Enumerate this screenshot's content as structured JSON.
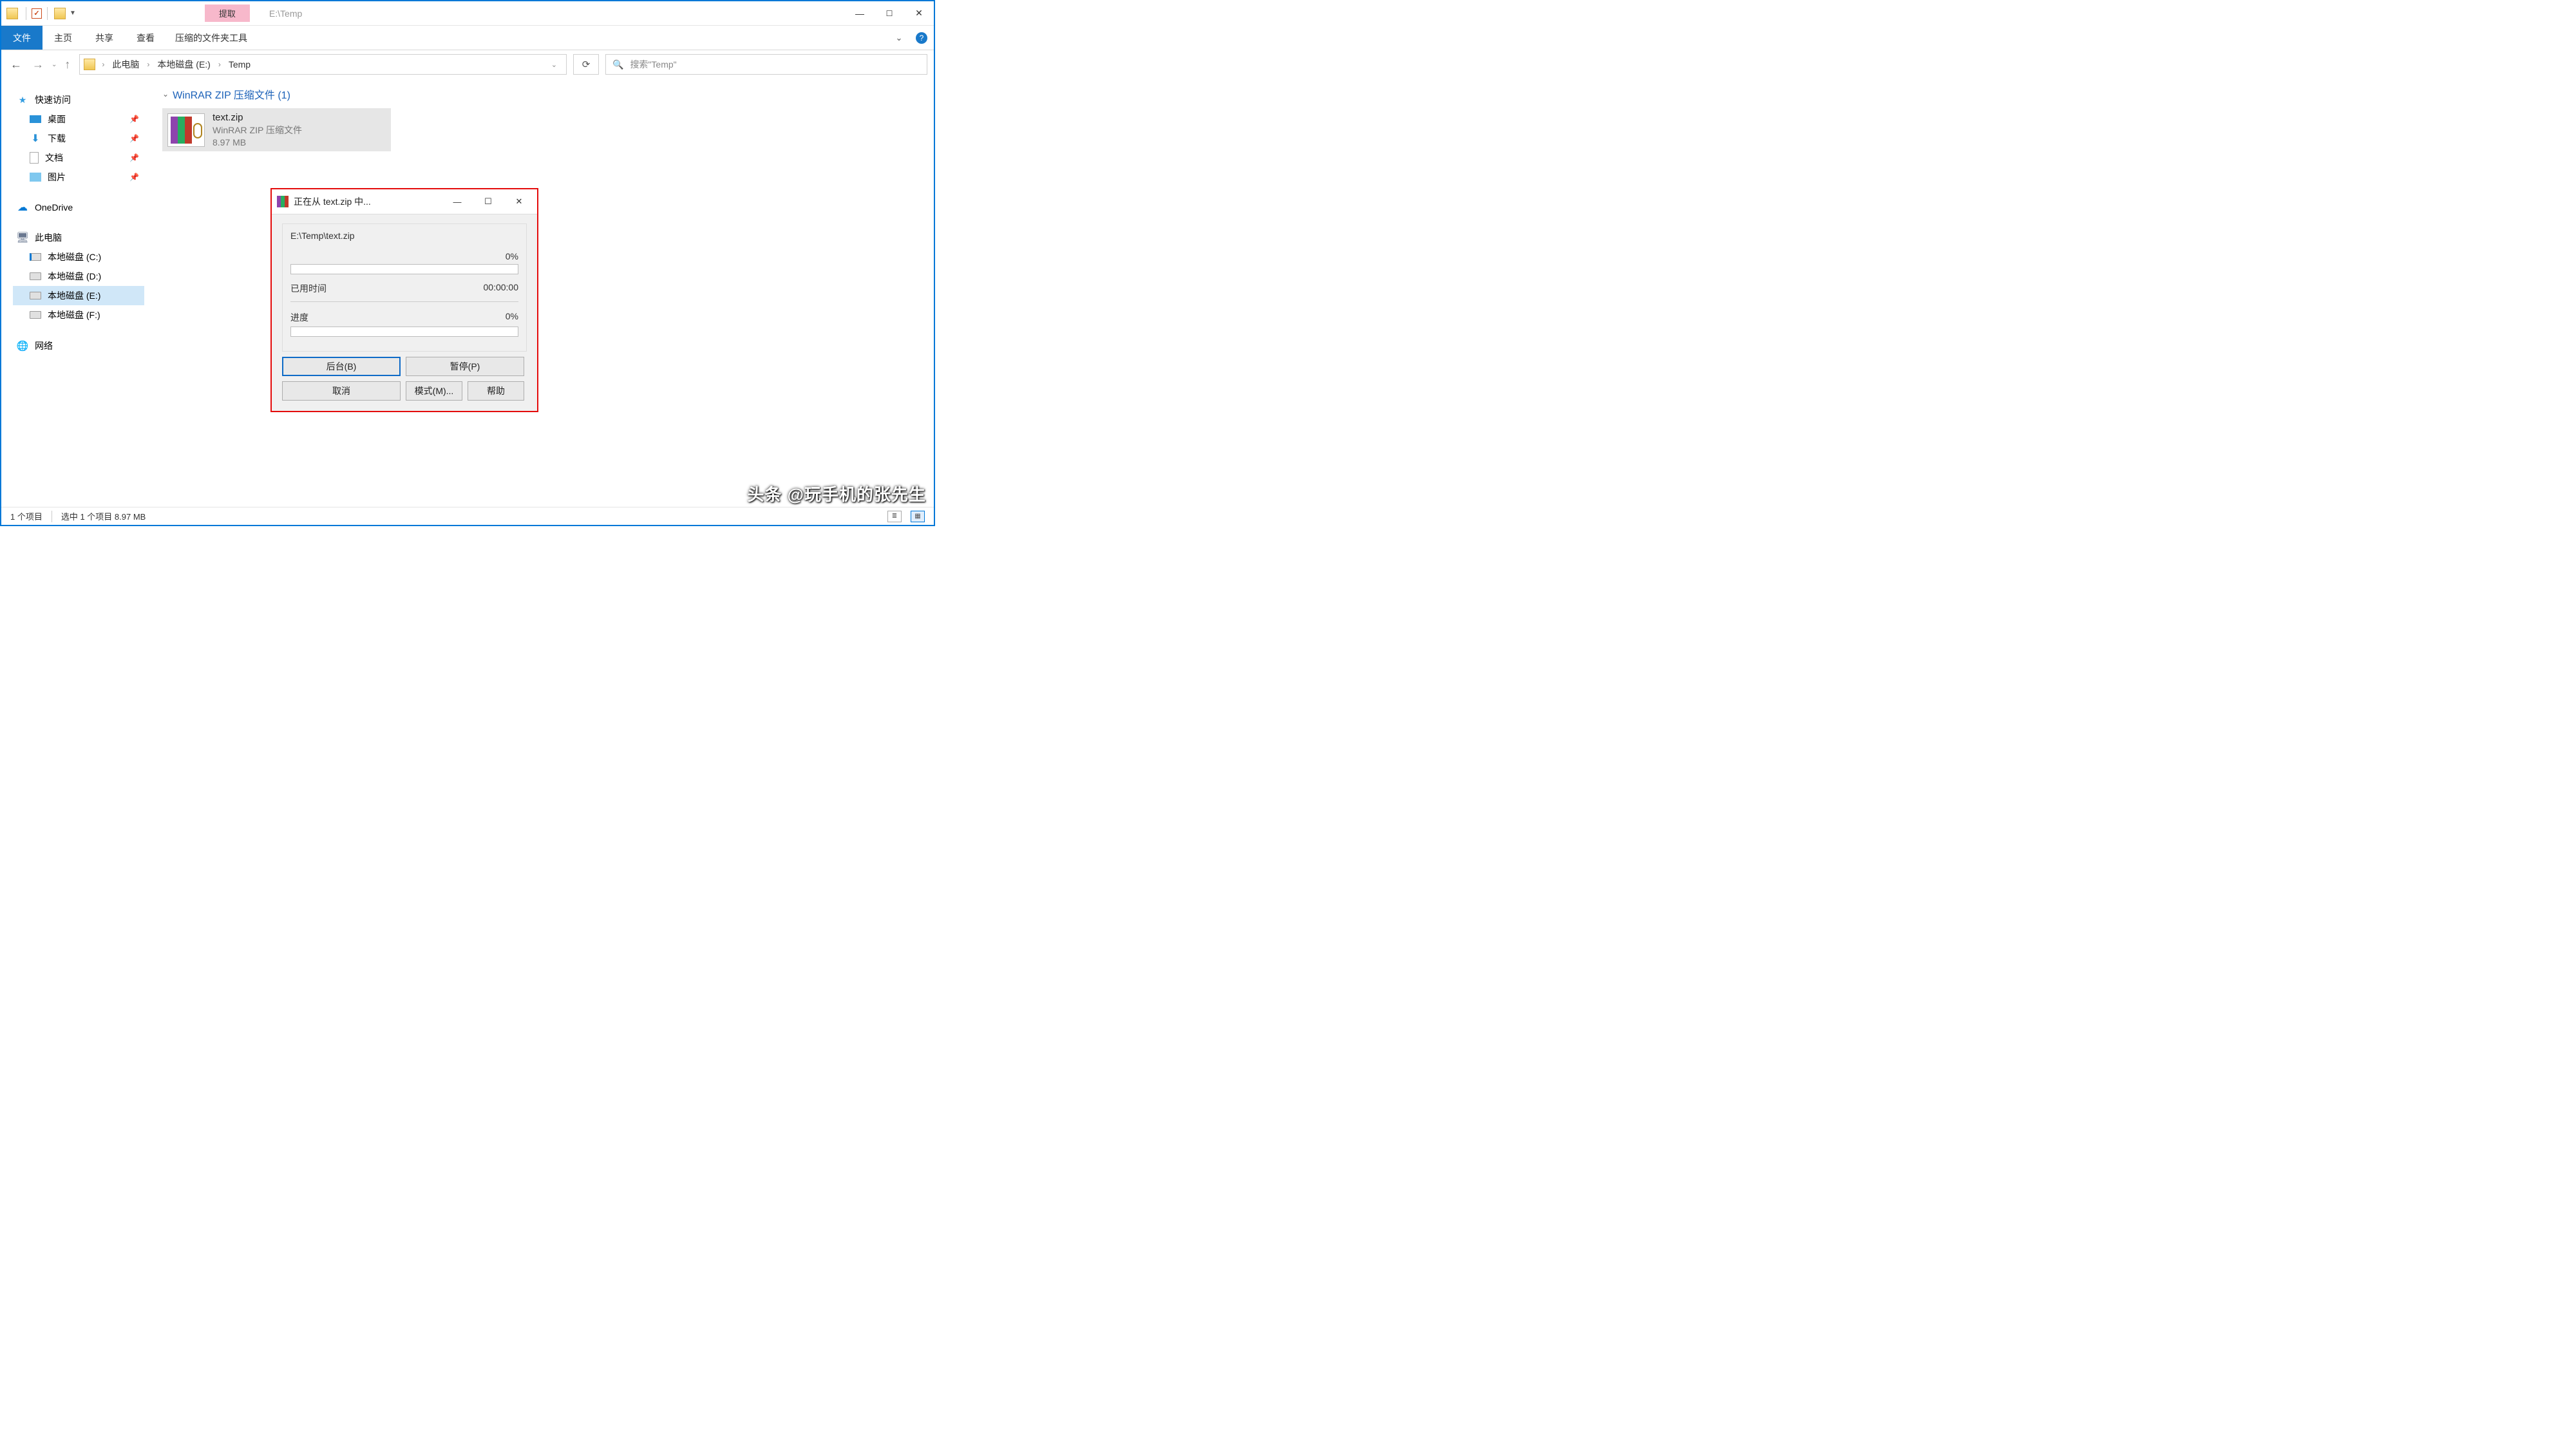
{
  "title": "E:\\Temp",
  "contextual_tab": "提取",
  "ribbon": {
    "file": "文件",
    "home": "主页",
    "share": "共享",
    "view": "查看",
    "ctx_tools": "压缩的文件夹工具"
  },
  "breadcrumbs": [
    "此电脑",
    "本地磁盘 (E:)",
    "Temp"
  ],
  "search_placeholder": "搜索\"Temp\"",
  "sidebar": {
    "quick": {
      "label": "快速访问",
      "items": [
        {
          "label": "桌面",
          "pin": true
        },
        {
          "label": "下载",
          "pin": true
        },
        {
          "label": "文档",
          "pin": true
        },
        {
          "label": "图片",
          "pin": true
        }
      ]
    },
    "onedrive": "OneDrive",
    "thispc": {
      "label": "此电脑",
      "drives": [
        {
          "label": "本地磁盘 (C:)"
        },
        {
          "label": "本地磁盘 (D:)"
        },
        {
          "label": "本地磁盘 (E:)",
          "selected": true
        },
        {
          "label": "本地磁盘 (F:)"
        }
      ]
    },
    "network": "网络"
  },
  "group_header": "WinRAR ZIP 压缩文件 (1)",
  "file": {
    "name": "text.zip",
    "type": "WinRAR ZIP 压缩文件",
    "size": "8.97 MB"
  },
  "dialog": {
    "title": "正在从 text.zip 中...",
    "path": "E:\\Temp\\text.zip",
    "percent1": "0%",
    "elapsed_label": "已用时间",
    "elapsed_value": "00:00:00",
    "progress_label": "进度",
    "percent2": "0%",
    "buttons": {
      "bg": "后台(B)",
      "pause": "暂停(P)",
      "cancel": "取消",
      "mode": "模式(M)...",
      "help": "帮助"
    }
  },
  "status": {
    "count": "1 个项目",
    "selected": "选中 1 个项目 8.97 MB"
  },
  "watermark": "头条 @玩手机的张先生"
}
